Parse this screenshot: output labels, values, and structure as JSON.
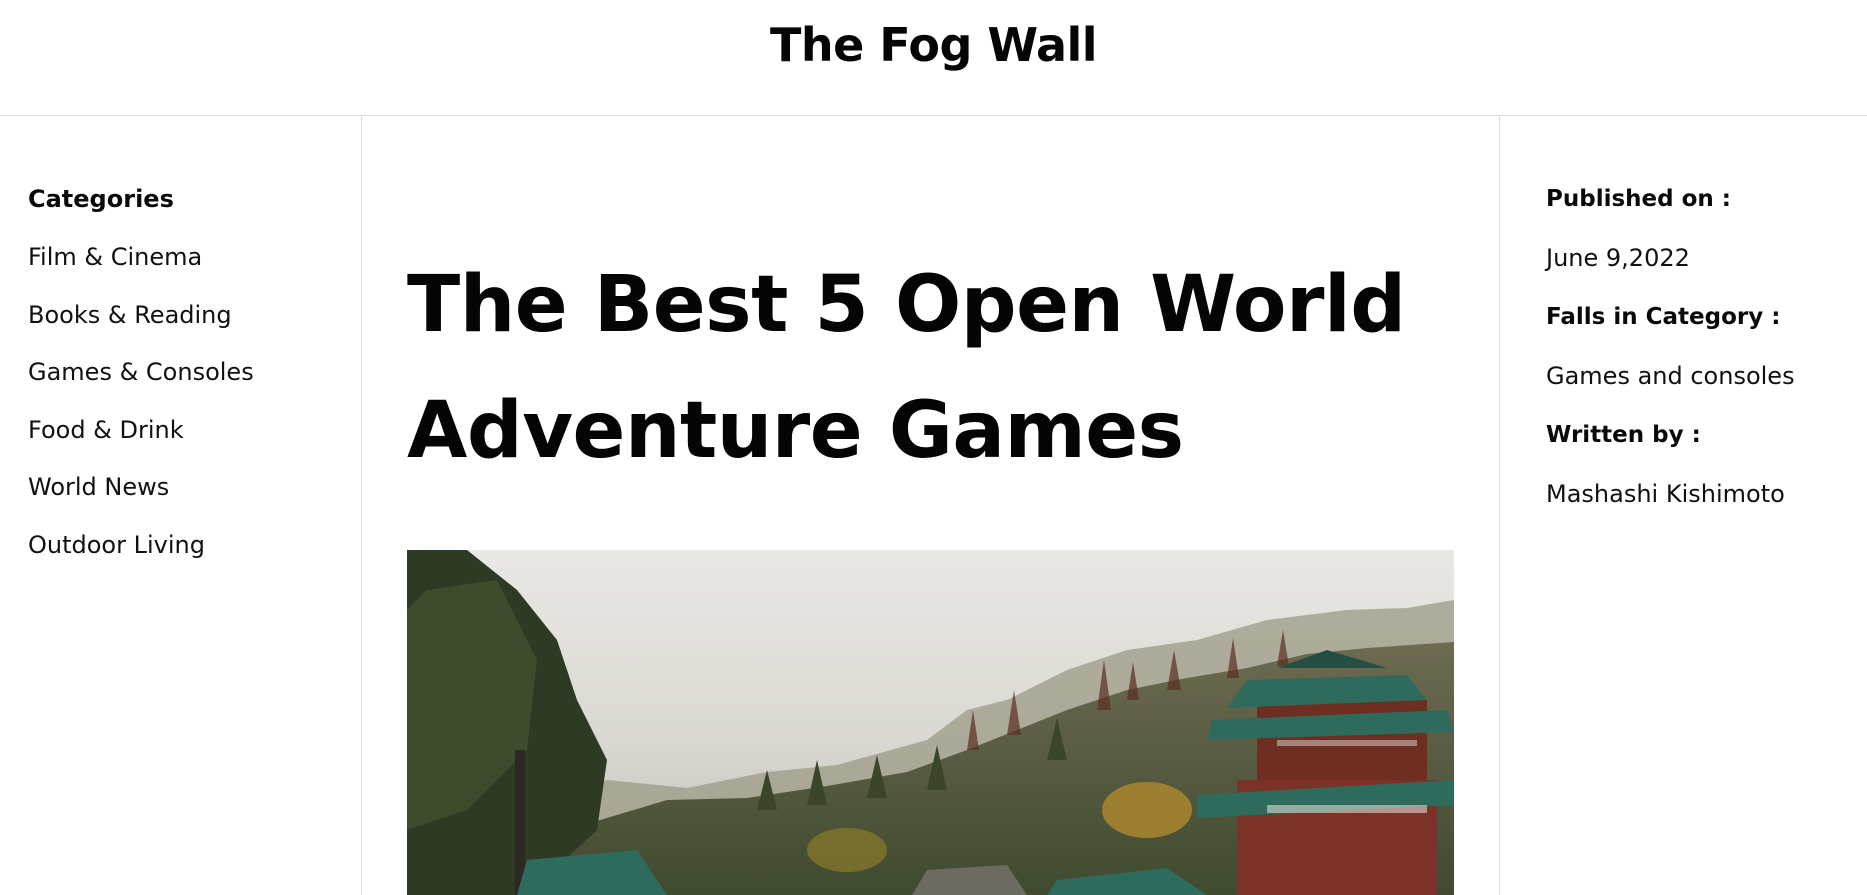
{
  "site": {
    "title": "The Fog Wall"
  },
  "categories": {
    "heading": "Categories",
    "items": [
      {
        "label": "Film & Cinema"
      },
      {
        "label": "Books & Reading"
      },
      {
        "label": "Games & Consoles"
      },
      {
        "label": "Food & Drink"
      },
      {
        "label": "World News"
      },
      {
        "label": "Outdoor Living"
      }
    ]
  },
  "article": {
    "title_line1": "The Best 5 Open World",
    "title_line2": "Adventure Games",
    "hero_image": "misty forest mountain with pagoda temple"
  },
  "meta": {
    "published_label": "Published on :",
    "published_value": "June 9,2022",
    "category_label": "Falls in Category :",
    "category_value": "Games and consoles",
    "author_label": "Written by :",
    "author_value": "Mashashi Kishimoto"
  },
  "colors": {
    "text": "#0a0a0a",
    "border": "#dedede",
    "background": "#ffffff",
    "fog": "#e4e3df",
    "forest": "#4a5232",
    "roof": "#2f6b5c",
    "wall": "#7a3326"
  }
}
